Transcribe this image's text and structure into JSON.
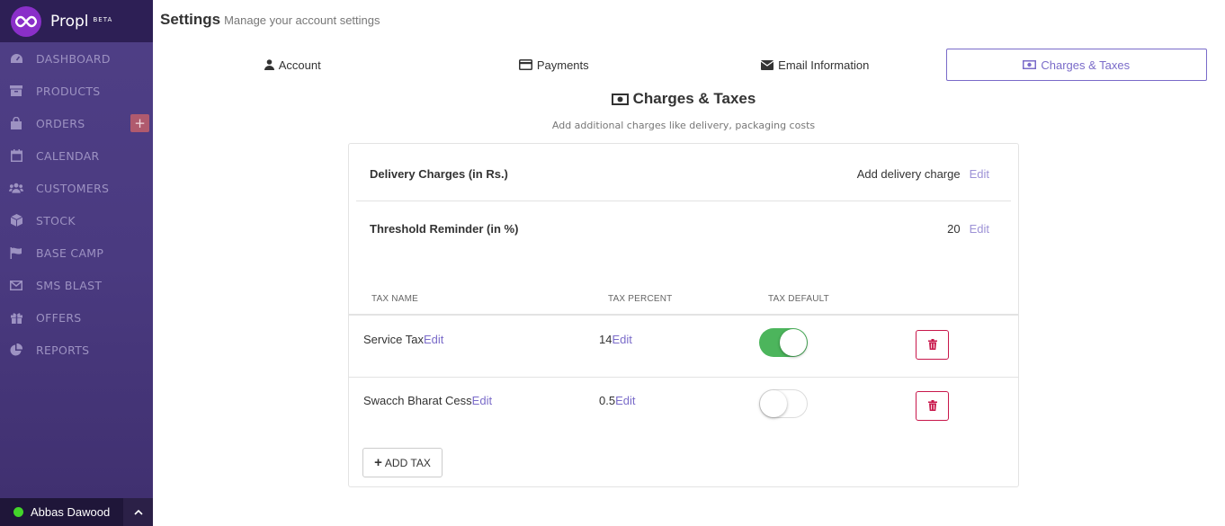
{
  "brand": {
    "name": "Propl",
    "badge": "BETA"
  },
  "sidebar": {
    "items": [
      {
        "label": "DASHBOARD",
        "icon": "dashboard-icon"
      },
      {
        "label": "PRODUCTS",
        "icon": "archive-icon"
      },
      {
        "label": "ORDERS",
        "icon": "shopping-bag-icon"
      },
      {
        "label": "CALENDAR",
        "icon": "calendar-icon"
      },
      {
        "label": "CUSTOMERS",
        "icon": "users-icon"
      },
      {
        "label": "STOCK",
        "icon": "cube-icon"
      },
      {
        "label": "BASE CAMP",
        "icon": "flag-icon"
      },
      {
        "label": "SMS BLAST",
        "icon": "envelope-icon"
      },
      {
        "label": "OFFERS",
        "icon": "gift-icon"
      },
      {
        "label": "REPORTS",
        "icon": "pie-chart-icon"
      }
    ],
    "orders_add_label": "+"
  },
  "user": {
    "name": "Abbas Dawood",
    "status_color": "#43d52a"
  },
  "header": {
    "title": "Settings",
    "subtitle": "Manage your account settings"
  },
  "tabs": [
    {
      "label": "Account",
      "icon": "user-icon"
    },
    {
      "label": "Payments",
      "icon": "credit-card-icon"
    },
    {
      "label": "Email Information",
      "icon": "envelope-icon"
    },
    {
      "label": "Charges & Taxes",
      "icon": "money-icon",
      "active": true
    }
  ],
  "section": {
    "title": "Charges & Taxes",
    "subtitle": "Add additional charges like delivery, packaging costs"
  },
  "charges": {
    "delivery": {
      "label": "Delivery Charges (in Rs.)",
      "value": "Add delivery charge",
      "edit": "Edit"
    },
    "threshold": {
      "label": "Threshold Reminder (in %)",
      "value": "20",
      "edit": "Edit"
    }
  },
  "tax_table": {
    "headers": [
      "TAX NAME",
      "TAX PERCENT",
      "TAX DEFAULT"
    ],
    "rows": [
      {
        "name": "Service Tax",
        "name_edit": "Edit",
        "percent": "14",
        "percent_edit": "Edit",
        "default": true
      },
      {
        "name": "Swacch Bharat Cess",
        "name_edit": "Edit",
        "percent": "0.5",
        "percent_edit": "Edit",
        "default": false
      }
    ],
    "add_label": "ADD TAX"
  },
  "colors": {
    "accent": "#7a6bc9",
    "toggle_on": "#4cb55c",
    "danger": "#c8174b",
    "sidebar": "#4a3a80"
  }
}
